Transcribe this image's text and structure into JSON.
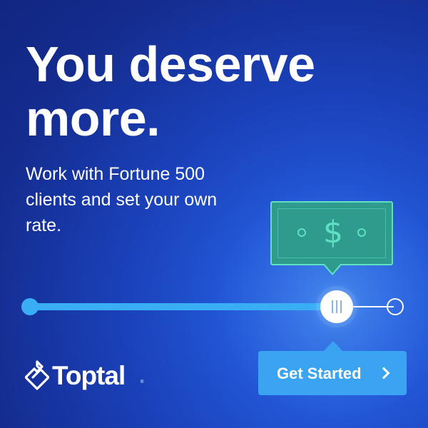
{
  "ad": {
    "headline": "You deserve more.",
    "subtext": "Work with Fortune 500 clients and set your own rate.",
    "bill": {
      "symbol": "$",
      "icon": "dollar-bill-icon"
    },
    "slider": {
      "value_fraction": 0.84
    },
    "cta": {
      "label": "Get Started",
      "icon": "chevron-right-icon"
    },
    "brand": {
      "name": "Toptal",
      "registered_mark": "®",
      "icon": "toptal-logo-icon"
    },
    "colors": {
      "background": "#1a40b8",
      "accent": "#3aa3f2",
      "bill": "#2f9a8e",
      "bill_outline": "#5fe0c0",
      "text": "#ffffff"
    }
  }
}
